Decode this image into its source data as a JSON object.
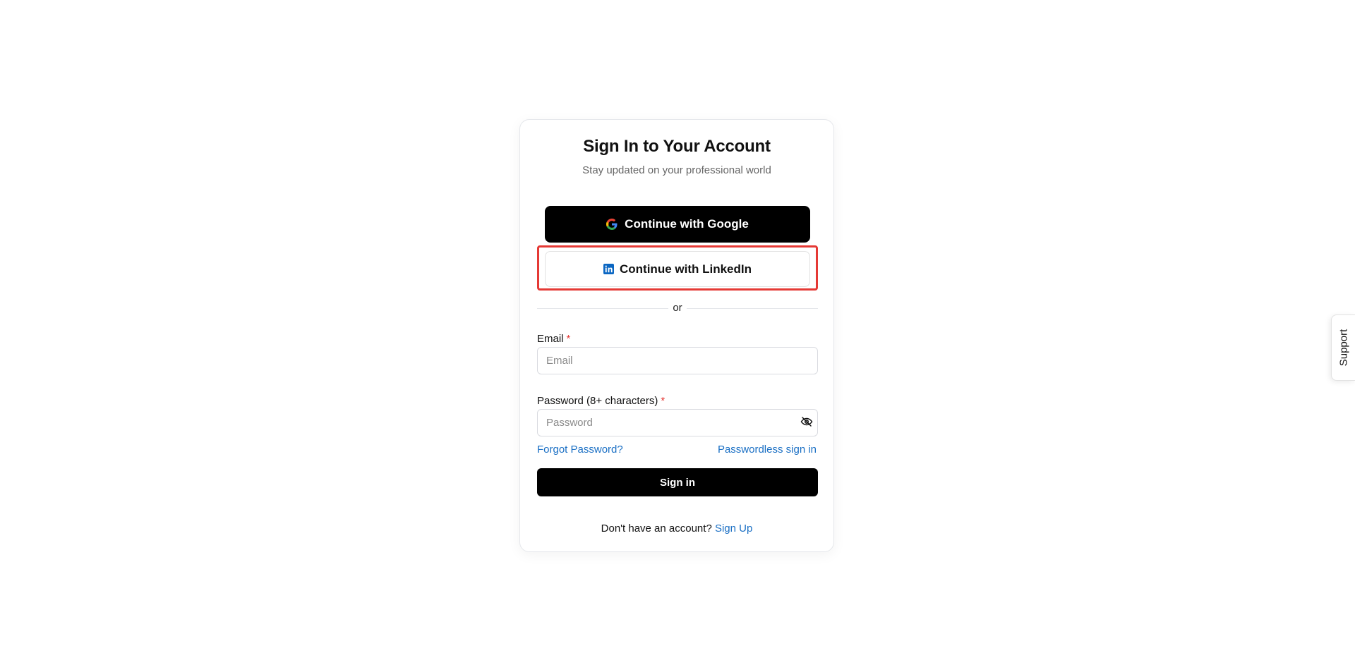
{
  "header": {
    "title": "Sign In to Your Account",
    "subtitle": "Stay updated on your professional world"
  },
  "social": {
    "google_label": "Continue with Google",
    "google_icon": "google-icon",
    "linkedin_label": "Continue with LinkedIn",
    "linkedin_icon": "linkedin-icon",
    "linkedin_brand_color": "#0a66c2",
    "highlight_color": "#e53935"
  },
  "divider": {
    "text": "or"
  },
  "form": {
    "email_label": "Email",
    "email_required": "*",
    "email_value": "",
    "email_placeholder": "Email",
    "password_label": "Password (8+ characters)",
    "password_required": "*",
    "password_value": "",
    "password_placeholder": "Password",
    "password_toggle_icon": "eye-off-icon",
    "forgot_password": "Forgot Password?",
    "passwordless": "Passwordless sign in",
    "submit_label": "Sign in"
  },
  "footer": {
    "prompt": "Don't have an account?",
    "signup_link": "Sign Up"
  },
  "support": {
    "label": "Support"
  },
  "colors": {
    "primary_button": "#000000",
    "link": "#1a6fc4",
    "required": "#e53935"
  }
}
